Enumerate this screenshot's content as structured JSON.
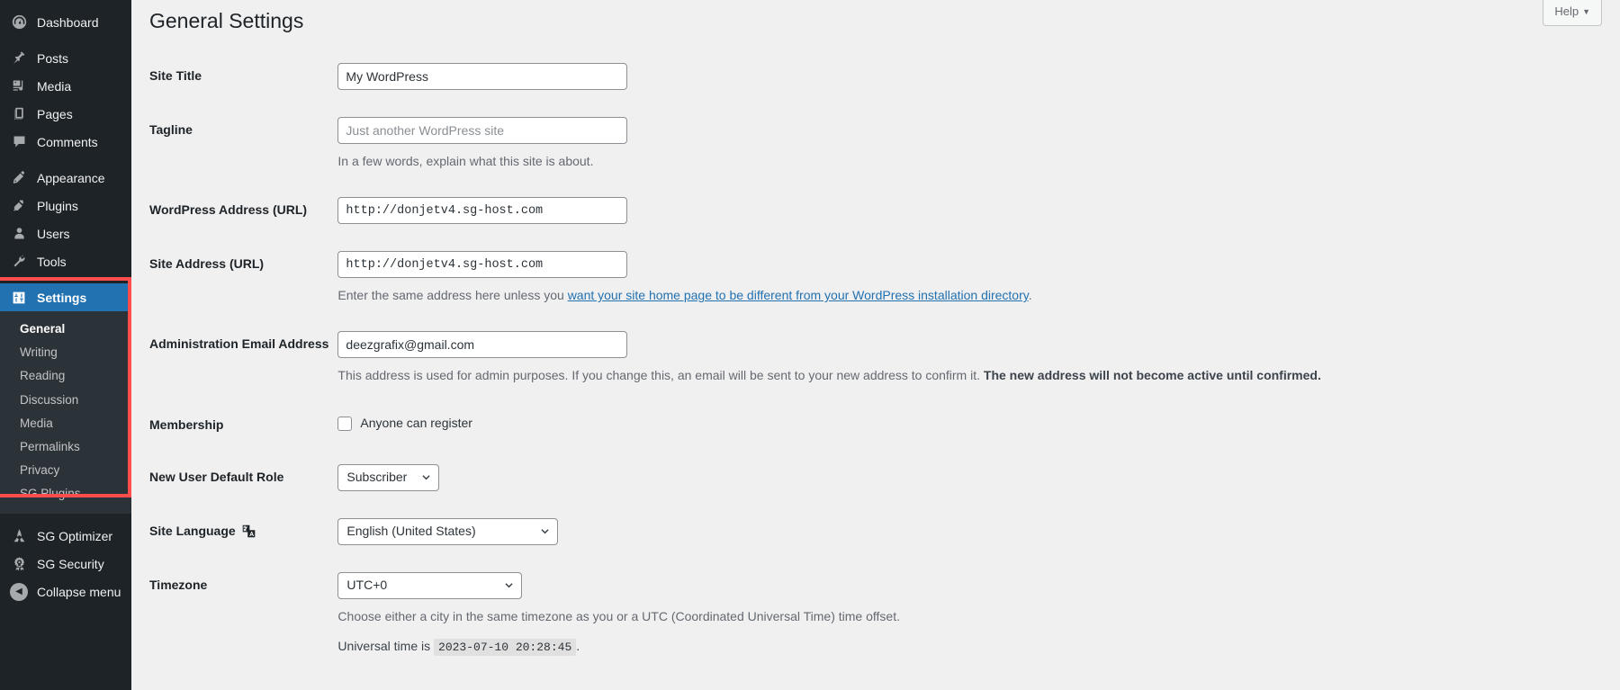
{
  "sidebar": {
    "items": [
      {
        "label": "Dashboard",
        "icon": "dashboard-icon",
        "name": "sidebar-item-dashboard"
      },
      {
        "label": "Posts",
        "icon": "pin-icon",
        "name": "sidebar-item-posts"
      },
      {
        "label": "Media",
        "icon": "media-icon",
        "name": "sidebar-item-media"
      },
      {
        "label": "Pages",
        "icon": "pages-icon",
        "name": "sidebar-item-pages"
      },
      {
        "label": "Comments",
        "icon": "comment-icon",
        "name": "sidebar-item-comments"
      },
      {
        "label": "Appearance",
        "icon": "brush-icon",
        "name": "sidebar-item-appearance"
      },
      {
        "label": "Plugins",
        "icon": "plug-icon",
        "name": "sidebar-item-plugins"
      },
      {
        "label": "Users",
        "icon": "user-icon",
        "name": "sidebar-item-users"
      },
      {
        "label": "Tools",
        "icon": "wrench-icon",
        "name": "sidebar-item-tools"
      }
    ],
    "settings": {
      "label": "Settings",
      "icon": "settings-sliders-icon",
      "submenu": [
        {
          "label": "General",
          "current": true
        },
        {
          "label": "Writing",
          "current": false
        },
        {
          "label": "Reading",
          "current": false
        },
        {
          "label": "Discussion",
          "current": false
        },
        {
          "label": "Media",
          "current": false
        },
        {
          "label": "Permalinks",
          "current": false
        },
        {
          "label": "Privacy",
          "current": false
        },
        {
          "label": "SG Plugins",
          "current": false
        }
      ]
    },
    "bottom_items": [
      {
        "label": "SG Optimizer",
        "icon": "sg-optimizer-icon",
        "name": "sidebar-item-sg-optimizer"
      },
      {
        "label": "SG Security",
        "icon": "sg-security-icon",
        "name": "sidebar-item-sg-security"
      }
    ],
    "collapse": {
      "label": "Collapse menu",
      "icon": "collapse-left-icon"
    },
    "highlight_color": "#ff4d4d",
    "active_color": "#2271b1"
  },
  "header": {
    "help_label": "Help",
    "help_caret": "▼"
  },
  "main": {
    "page_title": "General Settings",
    "fields": {
      "site_title": {
        "label": "Site Title",
        "value": "My WordPress"
      },
      "tagline": {
        "label": "Tagline",
        "value": "",
        "placeholder": "Just another WordPress site",
        "description": "In a few words, explain what this site is about."
      },
      "wordpress_address": {
        "label": "WordPress Address (URL)",
        "value": "http://donjetv4.sg-host.com"
      },
      "site_address": {
        "label": "Site Address (URL)",
        "value": "http://donjetv4.sg-host.com",
        "description_before": "Enter the same address here unless you ",
        "description_link": "want your site home page to be different from your WordPress installation directory",
        "description_after": "."
      },
      "admin_email": {
        "label": "Administration Email Address",
        "value": "deezgrafix@gmail.com",
        "description_normal": "This address is used for admin purposes. If you change this, an email will be sent to your new address to confirm it. ",
        "description_bold": "The new address will not become active until confirmed."
      },
      "membership": {
        "label": "Membership",
        "checkbox_label": "Anyone can register",
        "checked": false
      },
      "new_user_role": {
        "label": "New User Default Role",
        "value": "Subscriber"
      },
      "site_language": {
        "label": "Site Language",
        "icon": "translation-icon",
        "value": "English (United States)"
      },
      "timezone": {
        "label": "Timezone",
        "value": "UTC+0",
        "description": "Choose either a city in the same timezone as you or a UTC (Coordinated Universal Time) time offset.",
        "universal_time_prefix": "Universal time is",
        "universal_time_value": "2023-07-10 20:28:45",
        "universal_time_suffix": "."
      }
    }
  }
}
